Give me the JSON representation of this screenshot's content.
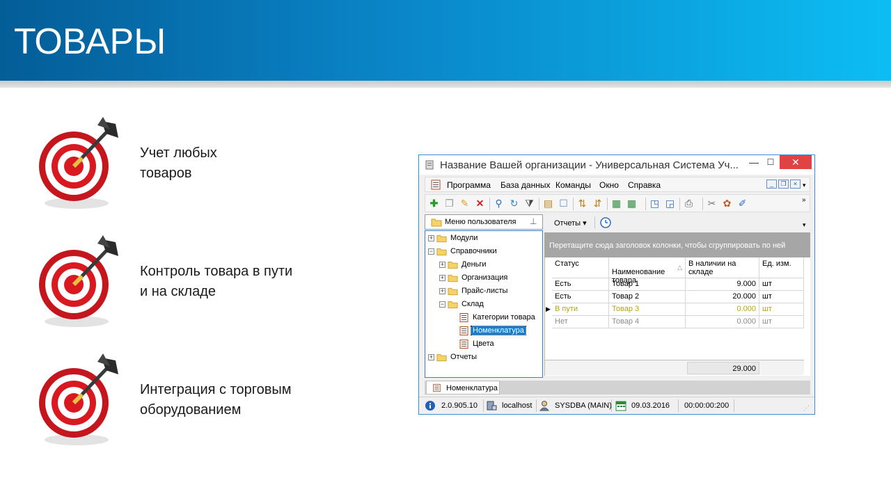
{
  "slide": {
    "title": "ТОВАРЫ",
    "bullets": [
      {
        "text": "Учет любых\nтоваров"
      },
      {
        "text": "Контроль товара в пути\nи на складе"
      },
      {
        "text": "Интеграция с торговым\nоборудованием"
      }
    ]
  },
  "window": {
    "title": "Название Вашей организации - Универсальная Система Уч...",
    "controls": {
      "minimize": "—",
      "maximize": "☐",
      "close": "✕"
    },
    "menu": [
      "Программа",
      "База данных",
      "Команды",
      "Окно",
      "Справка"
    ],
    "panel": {
      "title": "Меню пользователя",
      "tree": [
        {
          "label": "Модули",
          "level": 0,
          "expander": "+",
          "icon": "folder-icon"
        },
        {
          "label": "Справочники",
          "level": 0,
          "expander": "−",
          "icon": "folder-icon"
        },
        {
          "label": "Деньги",
          "level": 1,
          "expander": "+",
          "icon": "folder-icon"
        },
        {
          "label": "Организация",
          "level": 1,
          "expander": "+",
          "icon": "folder-icon"
        },
        {
          "label": "Прайс-листы",
          "level": 1,
          "expander": "+",
          "icon": "folder-icon"
        },
        {
          "label": "Склад",
          "level": 1,
          "expander": "−",
          "icon": "folder-icon"
        },
        {
          "label": "Категории товара",
          "level": 2,
          "expander": "",
          "icon": "form-icon"
        },
        {
          "label": "Номенклатура",
          "level": 2,
          "expander": "",
          "icon": "form-icon",
          "selected": true
        },
        {
          "label": "Цвета",
          "level": 2,
          "expander": "",
          "icon": "form-icon"
        },
        {
          "label": "Отчеты",
          "level": 0,
          "expander": "+",
          "icon": "folder-icon"
        }
      ]
    },
    "reports_label": "Отчеты ▾",
    "group_hint": "Перетащите сюда заголовок колонки, чтобы сгруппировать по ней",
    "grid": {
      "columns": [
        "Статус",
        "Наименование\nтовара",
        "В наличии на\nскладе",
        "Ед. изм."
      ],
      "sort_indicator": "△",
      "rows": [
        {
          "status": "Есть",
          "name": "Товар 1",
          "qty": "9.000",
          "unit": "шт",
          "color": "#000000"
        },
        {
          "status": "Есть",
          "name": "Товар 2",
          "qty": "20.000",
          "unit": "шт",
          "color": "#000000"
        },
        {
          "status": "В пути",
          "name": "Товар 3",
          "qty": "0.000",
          "unit": "шт",
          "color": "#b4a516",
          "current": true
        },
        {
          "status": "Нет",
          "name": "Товар 4",
          "qty": "0.000",
          "unit": "шт",
          "color": "#8c8c8c"
        }
      ],
      "total": "29.000"
    },
    "tab": "Номенклатура",
    "status": {
      "version": "2.0.905.10",
      "host": "localhost",
      "user": "SYSDBA (MAIN)",
      "date": "09.03.2016",
      "time": "00:00:00:200"
    }
  },
  "colors": {
    "banner_start": "#045d97",
    "banner_end": "#0cbdf3",
    "selection": "#0a7fd6",
    "in_transit": "#b4a516",
    "absent": "#8c8c8c"
  }
}
